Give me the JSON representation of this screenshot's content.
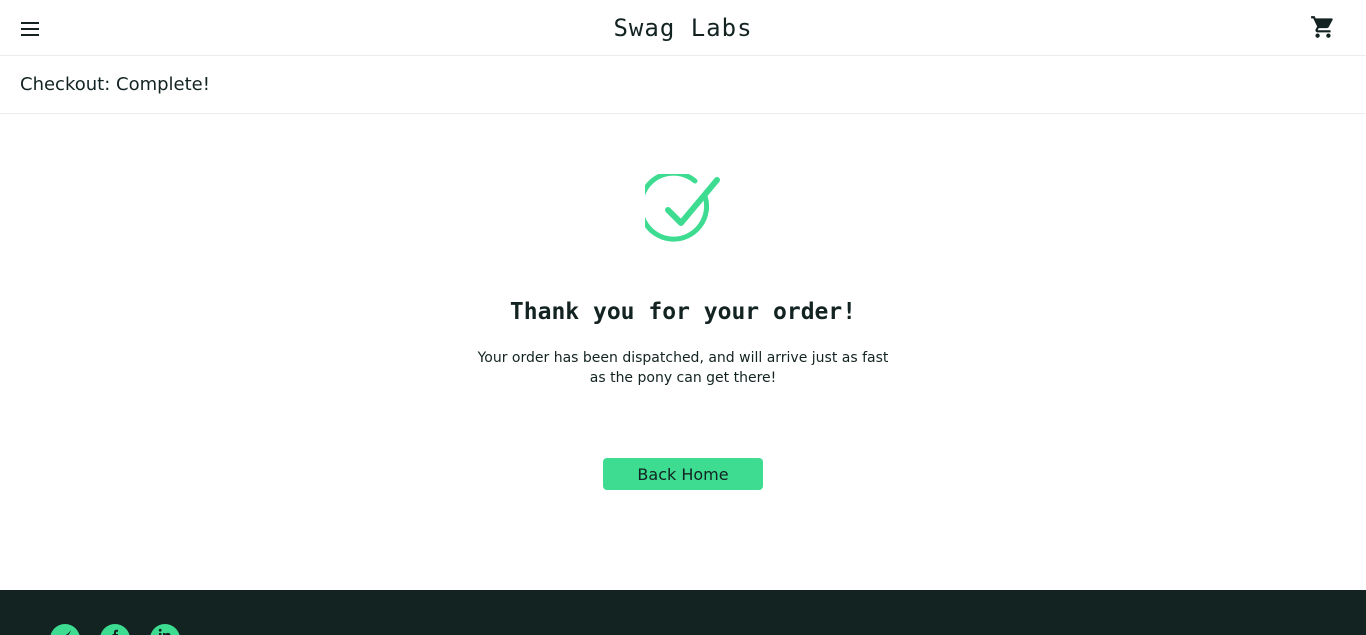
{
  "header": {
    "app_title": "Swag Labs",
    "menu_icon": "hamburger-menu-icon",
    "cart_icon": "shopping-cart-icon"
  },
  "subheader": {
    "title": "Checkout: Complete!"
  },
  "main": {
    "success_icon": "checkmark-circle-icon",
    "heading": "Thank you for your order!",
    "message": "Your order has been dispatched, and will arrive just as fast as the pony can get there!",
    "back_button_label": "Back Home"
  },
  "footer": {
    "social_icons": [
      "twitter-icon",
      "facebook-icon",
      "linkedin-icon"
    ]
  },
  "colors": {
    "accent": "#3ddc91",
    "dark": "#132322",
    "border": "#ededed"
  }
}
